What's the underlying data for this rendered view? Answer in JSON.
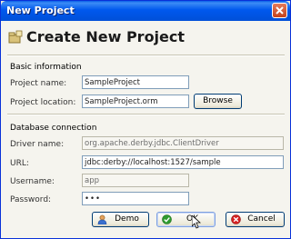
{
  "window": {
    "title": "New Project"
  },
  "header": {
    "title": "Create New Project",
    "icon": "new-project-icon"
  },
  "basic": {
    "section_label": "Basic information",
    "project_name_label": "Project name:",
    "project_name_value": "SampleProject",
    "project_location_label": "Project location:",
    "project_location_value": "SampleProject.orm",
    "browse_label": "Browse"
  },
  "database": {
    "section_label": "Database connection",
    "driver_label": "Driver name:",
    "driver_value": "org.apache.derby.jdbc.ClientDriver",
    "url_label": "URL:",
    "url_value": "jdbc:derby://localhost:1527/sample",
    "username_label": "Username:",
    "username_value": "app",
    "password_label": "Password:",
    "password_value": "•••"
  },
  "buttons": {
    "demo_label": "Demo",
    "ok_label": "OK",
    "cancel_label": "Cancel"
  },
  "colors": {
    "title_bar": "#0058ee",
    "accent_ok": "#2e9b2e",
    "accent_cancel": "#d62020"
  }
}
